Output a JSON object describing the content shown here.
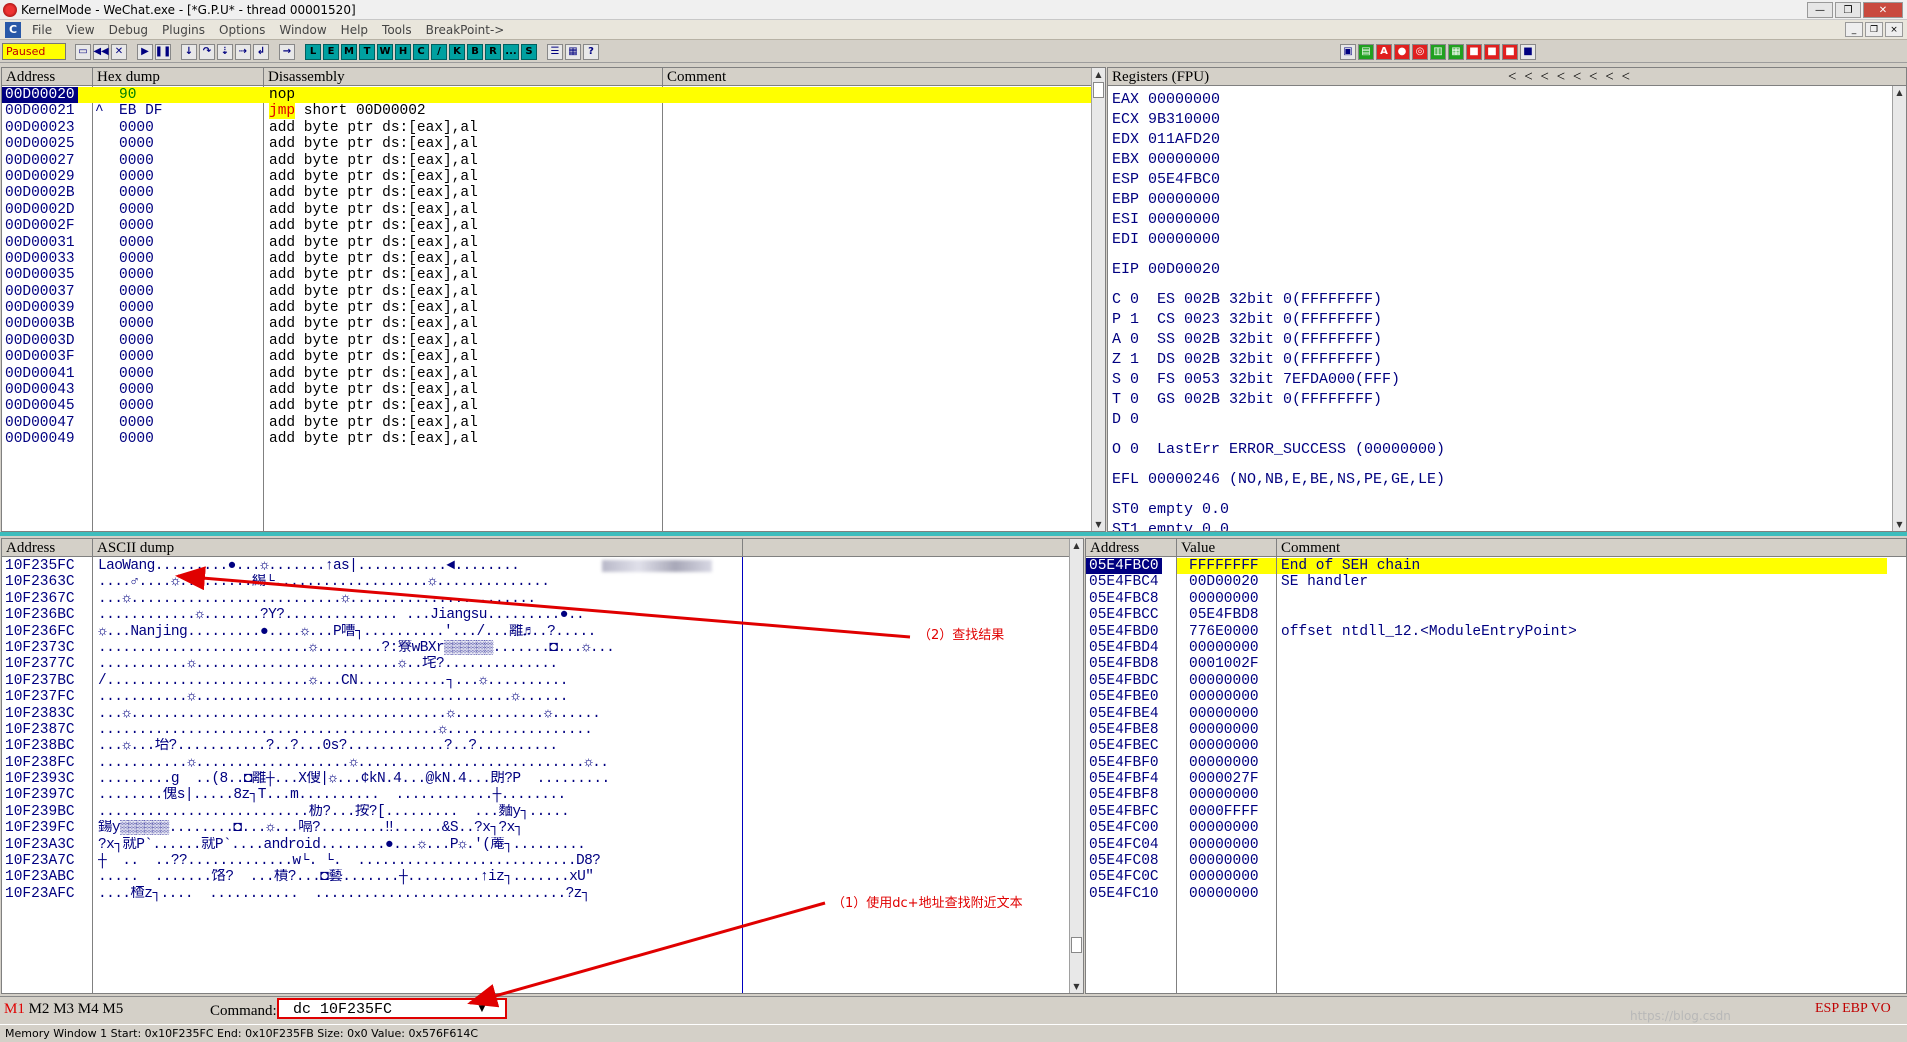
{
  "window": {
    "title": "KernelMode - WeChat.exe - [*G.P.U* - thread 00001520]",
    "buttons": [
      "—",
      "❐",
      "✕"
    ]
  },
  "menu": {
    "items": [
      "File",
      "View",
      "Debug",
      "Plugins",
      "Options",
      "Window",
      "Help",
      "Tools",
      "BreakPoint->"
    ],
    "mdi_buttons": [
      "_",
      "❐",
      "×"
    ]
  },
  "toolbar": {
    "status": "Paused",
    "letters": [
      "L",
      "E",
      "M",
      "T",
      "W",
      "H",
      "C",
      "/",
      "K",
      "B",
      "R",
      "...",
      "S"
    ]
  },
  "disasm": {
    "headers": [
      "Address",
      "Hex dump",
      "Disassembly",
      "Comment"
    ],
    "rows": [
      {
        "addr": "00D00020",
        "hex": "90",
        "mark": "",
        "asm": "nop",
        "asm_kw": "",
        "asm_rest": "nop"
      },
      {
        "addr": "00D00021",
        "hex": "EB DF",
        "mark": "^",
        "asm": "jmp short 00D00002",
        "asm_kw": "jmp",
        "asm_rest": " short 00D00002"
      },
      {
        "addr": "00D00023",
        "hex": "0000",
        "mark": "",
        "asm": "add byte ptr ds:[eax],al"
      },
      {
        "addr": "00D00025",
        "hex": "0000",
        "mark": "",
        "asm": "add byte ptr ds:[eax],al"
      },
      {
        "addr": "00D00027",
        "hex": "0000",
        "mark": "",
        "asm": "add byte ptr ds:[eax],al"
      },
      {
        "addr": "00D00029",
        "hex": "0000",
        "mark": "",
        "asm": "add byte ptr ds:[eax],al"
      },
      {
        "addr": "00D0002B",
        "hex": "0000",
        "mark": "",
        "asm": "add byte ptr ds:[eax],al"
      },
      {
        "addr": "00D0002D",
        "hex": "0000",
        "mark": "",
        "asm": "add byte ptr ds:[eax],al"
      },
      {
        "addr": "00D0002F",
        "hex": "0000",
        "mark": "",
        "asm": "add byte ptr ds:[eax],al"
      },
      {
        "addr": "00D00031",
        "hex": "0000",
        "mark": "",
        "asm": "add byte ptr ds:[eax],al"
      },
      {
        "addr": "00D00033",
        "hex": "0000",
        "mark": "",
        "asm": "add byte ptr ds:[eax],al"
      },
      {
        "addr": "00D00035",
        "hex": "0000",
        "mark": "",
        "asm": "add byte ptr ds:[eax],al"
      },
      {
        "addr": "00D00037",
        "hex": "0000",
        "mark": "",
        "asm": "add byte ptr ds:[eax],al"
      },
      {
        "addr": "00D00039",
        "hex": "0000",
        "mark": "",
        "asm": "add byte ptr ds:[eax],al"
      },
      {
        "addr": "00D0003B",
        "hex": "0000",
        "mark": "",
        "asm": "add byte ptr ds:[eax],al"
      },
      {
        "addr": "00D0003D",
        "hex": "0000",
        "mark": "",
        "asm": "add byte ptr ds:[eax],al"
      },
      {
        "addr": "00D0003F",
        "hex": "0000",
        "mark": "",
        "asm": "add byte ptr ds:[eax],al"
      },
      {
        "addr": "00D00041",
        "hex": "0000",
        "mark": "",
        "asm": "add byte ptr ds:[eax],al"
      },
      {
        "addr": "00D00043",
        "hex": "0000",
        "mark": "",
        "asm": "add byte ptr ds:[eax],al"
      },
      {
        "addr": "00D00045",
        "hex": "0000",
        "mark": "",
        "asm": "add byte ptr ds:[eax],al"
      },
      {
        "addr": "00D00047",
        "hex": "0000",
        "mark": "",
        "asm": "add byte ptr ds:[eax],al"
      },
      {
        "addr": "00D00049",
        "hex": "0000",
        "mark": "",
        "asm": "add byte ptr ds:[eax],al"
      }
    ]
  },
  "registers": {
    "header": "Registers (FPU)",
    "arrows": "<   <   <   <   <   <   <   <",
    "gp": [
      {
        "name": "EAX",
        "value": "00000000"
      },
      {
        "name": "ECX",
        "value": "9B310000"
      },
      {
        "name": "EDX",
        "value": "011AFD20"
      },
      {
        "name": "EBX",
        "value": "00000000"
      },
      {
        "name": "ESP",
        "value": "05E4FBC0"
      },
      {
        "name": "EBP",
        "value": "00000000"
      },
      {
        "name": "ESI",
        "value": "00000000"
      },
      {
        "name": "EDI",
        "value": "00000000"
      }
    ],
    "eip": "EIP 00D00020",
    "flags": [
      "C 0  ES 002B 32bit 0(FFFFFFFF)",
      "P 1  CS 0023 32bit 0(FFFFFFFF)",
      "A 0  SS 002B 32bit 0(FFFFFFFF)",
      "Z 1  DS 002B 32bit 0(FFFFFFFF)",
      "S 0  FS 0053 32bit 7EFDA000(FFF)",
      "T 0  GS 002B 32bit 0(FFFFFFFF)",
      "D 0",
      "O 0  LastErr ERROR_SUCCESS (00000000)"
    ],
    "efl": "EFL 00000246 (NO,NB,E,BE,NS,PE,GE,LE)",
    "fpu": [
      "ST0 empty 0.0",
      "ST1 empty 0.0"
    ]
  },
  "dump": {
    "headers": [
      "Address",
      "ASCII dump"
    ],
    "rows": [
      {
        "addr": "10F235FC",
        "text": "LaoWang.........●...☼.......↑as|...........◄........",
        "blur": true
      },
      {
        "addr": "10F2363C",
        "text": "....♂....☼.........緆└...................☼.............."
      },
      {
        "addr": "10F2367C",
        "text": "...☼..........................☼......................."
      },
      {
        "addr": "10F236BC",
        "text": "............☼.......?Y?.............. ...Jiangsu.........●.."
      },
      {
        "addr": "10F236FC",
        "text": "☼...Nanjing.........●....☼...P嘈┐..........'.../...離♬..?....."
      },
      {
        "addr": "10F2373C",
        "text": "..........................☼........?:簝wBXr▒▒▒▒▒▒.......◘...☼..."
      },
      {
        "addr": "10F2377C",
        "text": "...........☼.........................☼..垞?.............."
      },
      {
        "addr": "10F237BC",
        "text": "/.........................☼...CN...........┐...☼.........."
      },
      {
        "addr": "10F237FC",
        "text": "...........☼.......................................☼......"
      },
      {
        "addr": "10F2383C",
        "text": "...☼.......................................☼...........☼......"
      },
      {
        "addr": "10F2387C",
        "text": "..........................................☼.................."
      },
      {
        "addr": "10F238BC",
        "text": "...☼...坮?...........?..?...0s?............?..?.........."
      },
      {
        "addr": "10F238FC",
        "text": "...........☼...................☼............................☼.."
      },
      {
        "addr": "10F2393C",
        "text": ".........g  ..(8..◘離┼...X傁|☼...¢kN.4...@kN.4...朗?P  ........."
      },
      {
        "addr": "10F2397C",
        "text": "........傀s|.....8z┐T...m..........  ............┼........"
      },
      {
        "addr": "10F239BC",
        "text": "..........................枥?...按?[.........  ...麵y┐....."
      },
      {
        "addr": "10F239FC",
        "text": "鍚y▒▒▒▒▒▒........◘...☼...嗝?........‼......&S..?x┐?x┐"
      },
      {
        "addr": "10F23A3C",
        "text": "?x┐就P`......就P`....android........●...☼...P☼.'(蓭┐........."
      },
      {
        "addr": "10F23A7C",
        "text": "┼  ..  ..??.............w└. └.  ...........................D8?"
      },
      {
        "addr": "10F23ABC",
        "text": ".....  .......饹?  ...樍?...◘藝.......┼.........↑iz┐.......xU\""
      },
      {
        "addr": "10F23AFC",
        "text": "....楂z┐....  ...........  ...............................?z┐"
      }
    ]
  },
  "stack": {
    "headers": [
      "Address",
      "Value",
      "Comment"
    ],
    "rows": [
      {
        "addr": "05E4FBC0",
        "value": "FFFFFFFF",
        "comment": "End of SEH chain"
      },
      {
        "addr": "05E4FBC4",
        "value": "00D00020",
        "comment": "SE handler"
      },
      {
        "addr": "05E4FBC8",
        "value": "00000000",
        "comment": ""
      },
      {
        "addr": "05E4FBCC",
        "value": "05E4FBD8",
        "comment": ""
      },
      {
        "addr": "05E4FBD0",
        "value": "776E0000",
        "comment": "offset ntdll_12.<ModuleEntryPoint>"
      },
      {
        "addr": "05E4FBD4",
        "value": "00000000",
        "comment": ""
      },
      {
        "addr": "05E4FBD8",
        "value": "0001002F",
        "comment": ""
      },
      {
        "addr": "05E4FBDC",
        "value": "00000000",
        "comment": ""
      },
      {
        "addr": "05E4FBE0",
        "value": "00000000",
        "comment": ""
      },
      {
        "addr": "05E4FBE4",
        "value": "00000000",
        "comment": ""
      },
      {
        "addr": "05E4FBE8",
        "value": "00000000",
        "comment": ""
      },
      {
        "addr": "05E4FBEC",
        "value": "00000000",
        "comment": ""
      },
      {
        "addr": "05E4FBF0",
        "value": "00000000",
        "comment": ""
      },
      {
        "addr": "05E4FBF4",
        "value": "0000027F",
        "comment": ""
      },
      {
        "addr": "05E4FBF8",
        "value": "00000000",
        "comment": ""
      },
      {
        "addr": "05E4FBFC",
        "value": "0000FFFF",
        "comment": ""
      },
      {
        "addr": "05E4FC00",
        "value": "00000000",
        "comment": ""
      },
      {
        "addr": "05E4FC04",
        "value": "00000000",
        "comment": ""
      },
      {
        "addr": "05E4FC08",
        "value": "00000000",
        "comment": ""
      },
      {
        "addr": "05E4FC0C",
        "value": "00000000",
        "comment": ""
      },
      {
        "addr": "05E4FC10",
        "value": "00000000",
        "comment": ""
      }
    ]
  },
  "command": {
    "tabs": [
      "M1",
      "M2",
      "M3",
      "M4",
      "M5"
    ],
    "label": "Command:",
    "value": "dc 10F235FC",
    "right_text": "ESP EBP VO",
    "watermark": "https://blog.csdn"
  },
  "status": "Memory Window 1  Start:  0x10F235FC  End:  0x10F235FB  Size:  0x0 Value:  0x576F614C",
  "annotations": {
    "search_result": "（2）查找结果",
    "use_dc": "（1）使用dc+地址查找附近文本"
  },
  "colors": {
    "selection": "#000080",
    "highlight": "#ffff00",
    "annotation": "#e00000",
    "paused_bg": "#ffff00"
  }
}
